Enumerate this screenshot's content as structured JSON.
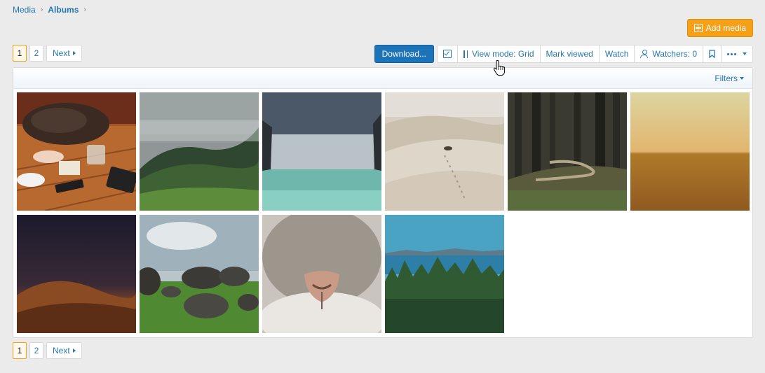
{
  "breadcrumb": {
    "items": [
      "Media",
      "Albums"
    ]
  },
  "actions": {
    "add_media": "Add media"
  },
  "pagination": {
    "pages": [
      "1",
      "2"
    ],
    "current": "1",
    "next": "Next"
  },
  "toolbar": {
    "download": "Download...",
    "view_mode": "View mode: Grid",
    "mark_viewed": "Mark viewed",
    "watch": "Watch",
    "watchers": "Watchers: 0"
  },
  "filters": {
    "label": "Filters"
  },
  "media": [
    {
      "subject": "desk-with-bag-and-phones"
    },
    {
      "subject": "foggy-green-hills"
    },
    {
      "subject": "sea-between-cliffs"
    },
    {
      "subject": "sand-dunes-footprints"
    },
    {
      "subject": "forest-path"
    },
    {
      "subject": "golden-field"
    },
    {
      "subject": "night-desert-dunes"
    },
    {
      "subject": "rocks-in-meadow"
    },
    {
      "subject": "cat-nose-closeup"
    },
    {
      "subject": "forest-by-sea"
    }
  ],
  "colors": {
    "accent": "#f4a018",
    "primary": "#1c73b7",
    "link": "#2577b1"
  }
}
